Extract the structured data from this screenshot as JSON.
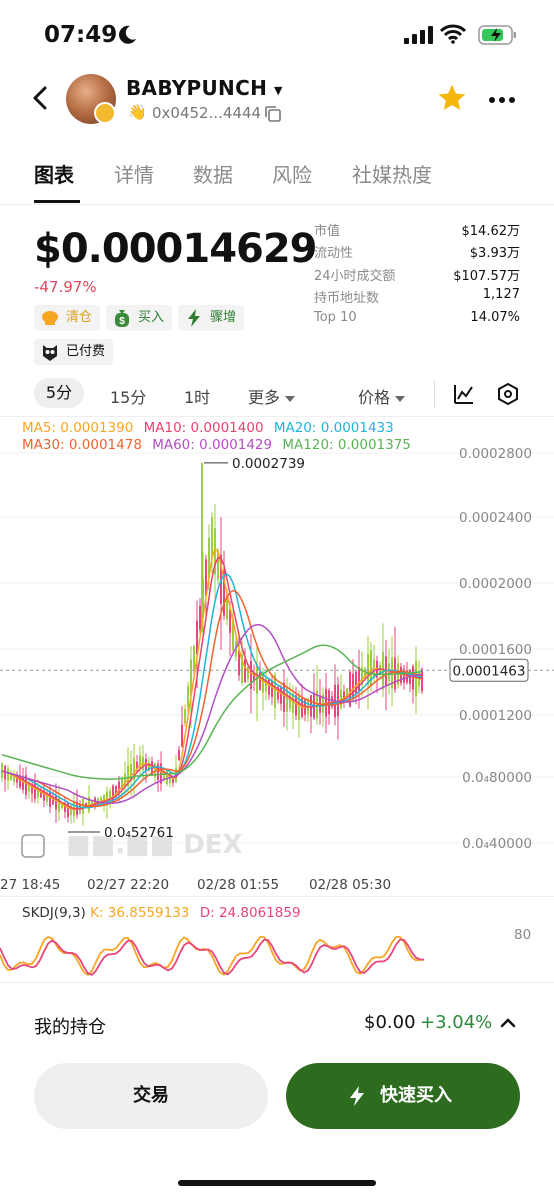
{
  "status": {
    "time": "07:49"
  },
  "header": {
    "token_name": "BABYPUNCH",
    "address": "0x0452...4444"
  },
  "tabs": [
    "图表",
    "详情",
    "数据",
    "风险",
    "社媒热度"
  ],
  "price": {
    "value": "$0.00014629",
    "change": "-47.97%"
  },
  "tags": {
    "clear": "清仓",
    "buy": "买入",
    "surge": "骤增",
    "paid": "已付费"
  },
  "stats": [
    {
      "k": "市值",
      "v": "$14.62万"
    },
    {
      "k": "流动性",
      "v": "$3.93万"
    },
    {
      "k": "24小时成交额",
      "v": "$107.57万"
    },
    {
      "k": "持币地址数",
      "v": "1,127"
    },
    {
      "k": "Top 10",
      "v": "14.07%"
    }
  ],
  "intervals": {
    "i1": "5分",
    "i2": "15分",
    "i3": "1时",
    "more": "更多",
    "price": "价格"
  },
  "ma_legend": {
    "ma5": "MA5: 0.0001390",
    "ma10": "MA10: 0.0001400",
    "ma20": "MA20: 0.0001433",
    "ma30": "MA30: 0.0001478",
    "ma60": "MA60: 0.0001429",
    "ma120": "MA120: 0.0001375"
  },
  "chart_data": {
    "type": "candlestick",
    "y_ticks": [
      "0.0002800",
      "0.0002400",
      "0.0002000",
      "0.0001600",
      "0.0001200",
      "0.0₄80000",
      "0.0₄40000"
    ],
    "x_ticks": [
      "27 18:45",
      "02/27 22:20",
      "02/28 01:55",
      "02/28 05:30"
    ],
    "current_price_label": "0.0001463",
    "high_label": "0.0002739",
    "low_label": "0.0₄52761",
    "watermark": "DEX",
    "ma_colors": {
      "ma5": "#f5a623",
      "ma10": "#e8456a",
      "ma20": "#23b3d6",
      "ma30": "#f2632c",
      "ma60": "#b34fc4",
      "ma120": "#5ab454"
    },
    "candle_up_color": "#9bcf3f",
    "candle_down_color": "#e8467c"
  },
  "skdj": {
    "label": "SKDJ(9,3)",
    "k": "K: 36.8559133",
    "d": "D: 24.8061859",
    "level": "80",
    "k_color": "#f5a623",
    "d_color": "#e8467c"
  },
  "position": {
    "title": "我的持仓",
    "value": "$0.00",
    "change": "+3.04%"
  },
  "actions": {
    "trade": "交易",
    "quick_buy": "快速买入"
  }
}
